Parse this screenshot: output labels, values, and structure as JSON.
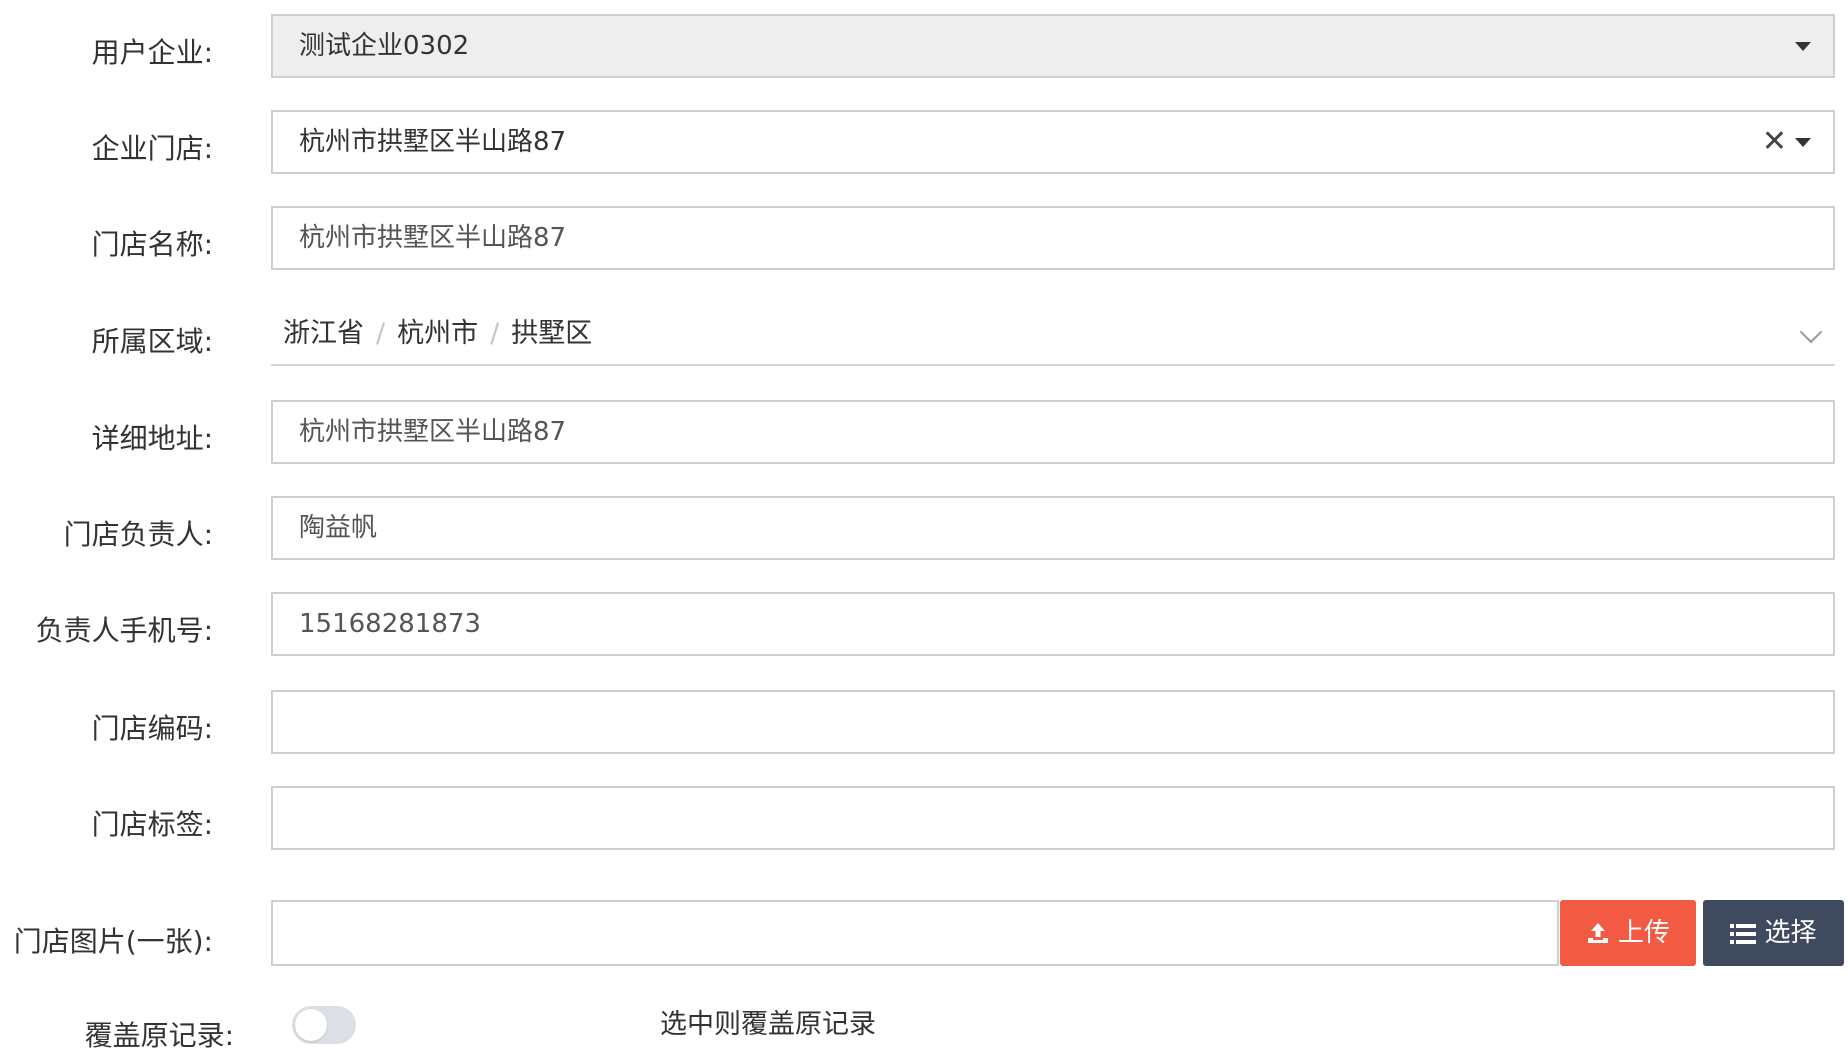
{
  "form": {
    "company": {
      "label": "用户企业:",
      "value": "测试企业0302"
    },
    "store": {
      "label": "企业门店:",
      "value": "杭州市拱墅区半山路87",
      "clear_glyph": "✕"
    },
    "store_name": {
      "label": "门店名称:",
      "value": "杭州市拱墅区半山路87"
    },
    "region": {
      "label": "所属区域:",
      "province": "浙江省",
      "city": "杭州市",
      "district": "拱墅区",
      "separator": "/"
    },
    "address": {
      "label": "详细地址:",
      "value": "杭州市拱墅区半山路87"
    },
    "manager": {
      "label": "门店负责人:",
      "value": "陶益帆"
    },
    "phone": {
      "label": "负责人手机号:",
      "value": "15168281873"
    },
    "store_code": {
      "label": "门店编码:",
      "value": ""
    },
    "store_tags": {
      "label": "门店标签:",
      "value": ""
    },
    "store_image": {
      "label": "门店图片(一张):",
      "upload_label": "上传",
      "choose_label": "选择"
    },
    "overwrite": {
      "label": "覆盖原记录:",
      "enabled": false,
      "hint": "选中则覆盖原记录"
    }
  },
  "colors": {
    "upload_button": "#f25a43",
    "choose_button": "#3f4a5e",
    "disabled_bg": "#eeeeee",
    "toggle_off": "#dcdfe6"
  }
}
